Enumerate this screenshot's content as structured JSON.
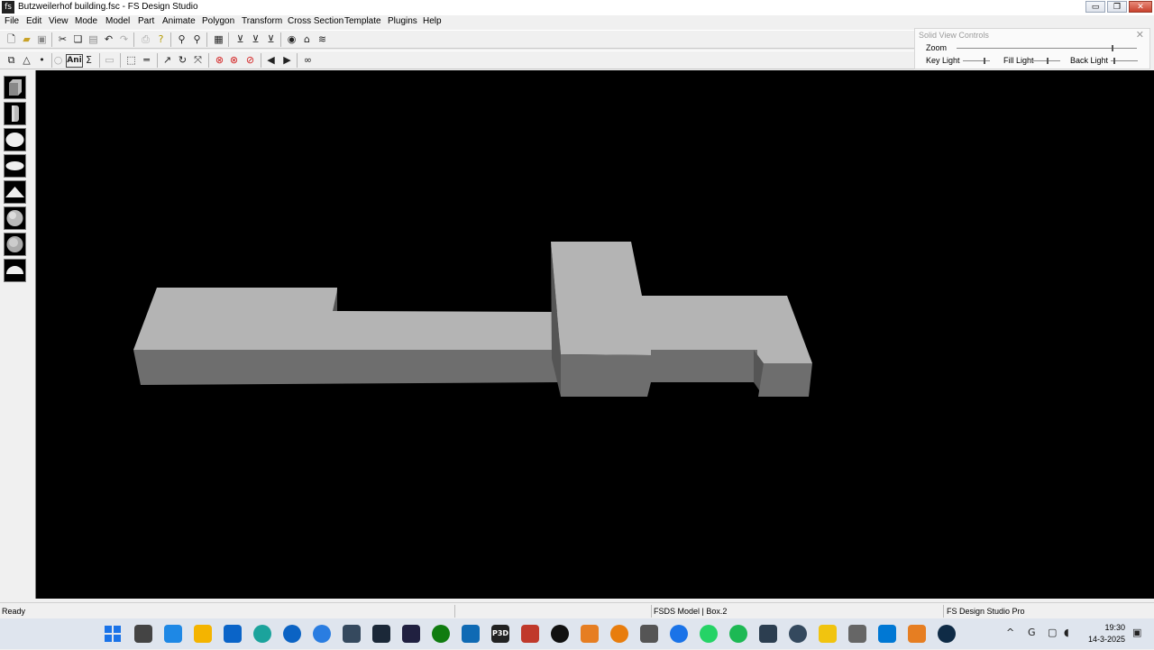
{
  "window": {
    "title": "Butzweilerhof building.fsc - FS Design Studio",
    "icon_text": "fs",
    "minimize_glyph": "▭",
    "restore_glyph": "❐",
    "close_glyph": "✕"
  },
  "menu": [
    "File",
    "Edit",
    "View",
    "Mode",
    "Model",
    "Part",
    "Animate",
    "Polygon",
    "Transform",
    "Cross Section",
    "Template",
    "Plugins",
    "Help"
  ],
  "toolbar1": {
    "icons": [
      "new-file-icon",
      "open-folder-icon",
      "save-icon",
      "cut-icon",
      "copy-icon",
      "paste-icon",
      "undo-icon",
      "redo-icon",
      "print-icon",
      "help-icon",
      "zoom-in-icon",
      "zoom-out-icon",
      "grid-icon",
      "mirror-x-icon",
      "mirror-y-icon",
      "mirror-z-icon",
      "eye-icon",
      "house-icon",
      "lines-icon"
    ]
  },
  "toolbar2": {
    "ani_label": "Ani",
    "sigma_label": "Σ",
    "icons": [
      "select-icon",
      "triangle-icon",
      "point-icon",
      "circle-icon",
      "ani-icon",
      "sigma-icon",
      "text-icon",
      "dotted-select-icon",
      "line-icon",
      "arrow-icon",
      "rotate-icon",
      "scale-icon",
      "no-entry-1-icon",
      "no-entry-2-icon",
      "no-entry-3-icon",
      "previous-icon",
      "next-icon",
      "binoculars-icon"
    ]
  },
  "solid_view_controls": {
    "title": "Solid View Controls",
    "close_glyph": "✕",
    "zoom_label": "Zoom",
    "key_light_label": "Key Light",
    "fill_light_label": "Fill Light",
    "back_light_label": "Back Light",
    "zoom_value": 0.86,
    "key_light_value": 0.75,
    "fill_light_value": 0.5,
    "back_light_value": 0.1
  },
  "shapes": [
    "box-icon",
    "cylinder-icon",
    "sphere-icon",
    "flat-ellipse-icon",
    "pyramid-icon",
    "geosphere-icon",
    "geosphere-2-icon",
    "hemisphere-icon"
  ],
  "viewport": {
    "background": "#000000",
    "model_colors": {
      "top": "#b4b4b4",
      "front": "#6e6e6e",
      "side": "#555555"
    }
  },
  "status": {
    "ready": "Ready",
    "model": "FSDS Model | Box.2",
    "app": "FS Design Studio Pro"
  },
  "taskbar": {
    "apps": [
      "start-icon",
      "task-view-icon",
      "mail-icon",
      "file-explorer-icon",
      "outlook-icon",
      "edge-icon",
      "edge-dev-icon",
      "globe-icon",
      "radar-icon",
      "steam-icon",
      "game-icon",
      "xbox-icon",
      "cloud-icon",
      "p3d-icon",
      "craft-icon",
      "logitech-icon",
      "music-icon",
      "blender-icon",
      "terrain-icon",
      "g-icon",
      "whatsapp-icon",
      "spotify-icon",
      "plane-icon",
      "gauge-icon",
      "check-icon",
      "fsds-icon",
      "vscode-icon",
      "slides-icon",
      "deepl-icon"
    ],
    "p3d_label": "P3D",
    "time": "19:30",
    "date": "14-3-2025"
  }
}
